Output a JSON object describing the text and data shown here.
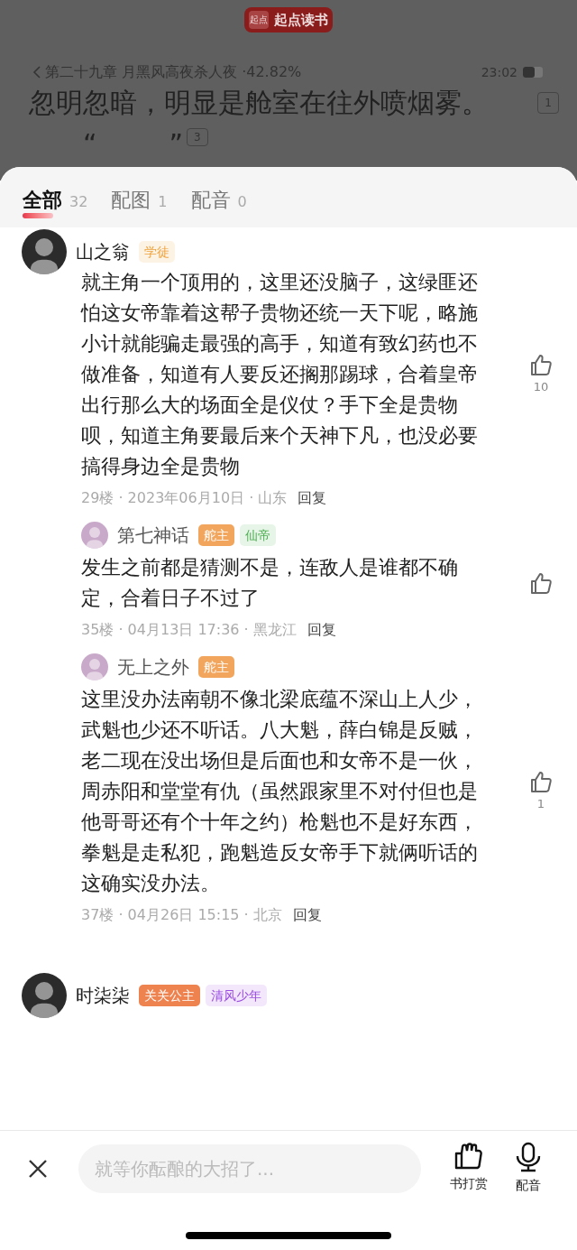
{
  "reader": {
    "logo_mark": "起点",
    "logo_text": "起点读书",
    "chapter": "第二十九章 月黑风高夜杀人夜 ·42.82%",
    "time": "23:02",
    "lines": [
      {
        "parts": [
          "忽明忽暗，明显是舱室在往外喷烟雾。"
        ],
        "comment_count": "1"
      },
      {
        "parts": [
          "“",
          "”"
        ],
        "comment_count": "3"
      }
    ]
  },
  "tabs": [
    {
      "label": "全部",
      "count": "32",
      "selected": true
    },
    {
      "label": "配图",
      "count": "1",
      "selected": false
    },
    {
      "label": "配音",
      "count": "0",
      "selected": false
    }
  ],
  "comments": [
    {
      "user": "山之翁",
      "badges": [
        {
          "label": "学徒",
          "kind": "soft",
          "color": "#f0a23c"
        }
      ],
      "text": "就主角一个顶用的，这里还没脑子，这绿匪还怕这女帝靠着这帮子贵物还统一天下呢，略施小计就能骗走最强的高手，知道有致幻药也不做准备，知道有人要反还搁那踢球，合着皇帝出行那么大的场面全是仪仗？手下全是贵物呗，知道主角要最后来个天神下凡，也没必要搞得身边全是贵物",
      "meta": "29楼 · 2023年06月10日 · 山东",
      "reply": "回复",
      "likes": "10",
      "replies": [
        {
          "user": "第七神话",
          "badges": [
            {
              "label": "舵主",
              "kind": "solid",
              "color": "#f2a55c"
            },
            {
              "label": "仙帝",
              "kind": "soft",
              "color": "#4caf50"
            }
          ],
          "text": "发生之前都是猜测不是，连敌人是谁都不确定，合着日子不过了",
          "meta": "35楼 · 04月13日 17:36 · 黑龙江",
          "reply": "回复"
        },
        {
          "user": "无上之外",
          "badges": [
            {
              "label": "舵主",
              "kind": "solid",
              "color": "#f2a55c"
            }
          ],
          "text": "这里没办法南朝不像北梁底蕴不深山上人少，武魁也少还不听话。八大魁，薛白锦是反贼，老二现在没出场但是后面也和女帝不是一伙，周赤阳和堂堂有仇（虽然跟家里不对付但也是他哥哥还有个十年之约）枪魁也不是好东西，拳魁是走私犯，跑魁造反女帝手下就俩听话的这确实没办法。",
          "meta": "37楼 · 04月26日 15:15 · 北京",
          "reply": "回复",
          "likes": "1"
        }
      ]
    },
    {
      "user": "时柒柒",
      "badges": [
        {
          "label": "关关公主",
          "kind": "solid",
          "color": "#ee8350"
        },
        {
          "label": "清风少年",
          "kind": "soft",
          "color": "#9b4de0"
        }
      ]
    }
  ],
  "composer": {
    "placeholder": "就等你酝酿的大招了..."
  },
  "actions": [
    {
      "kind": "reward",
      "label": "书打赏"
    },
    {
      "kind": "voice",
      "label": "配音"
    }
  ]
}
